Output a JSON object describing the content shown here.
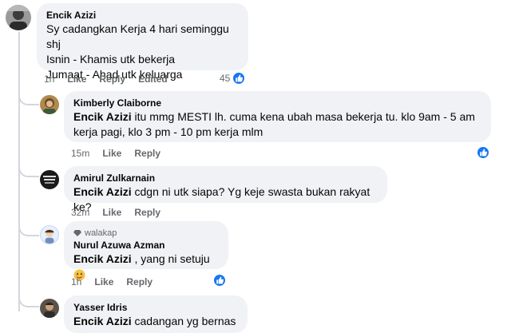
{
  "comments": [
    {
      "author": "Encik Azizi",
      "lines": [
        "Sy cadangkan Kerja 4 hari seminggu shj",
        "Isnin - Khamis utk bekerja",
        "Jumaat - Ahad utk keluarga"
      ],
      "time": "1h",
      "like": "Like",
      "reply": "Reply",
      "edited": "Edited",
      "reactions": "45"
    }
  ],
  "replies": [
    {
      "author": "Kimberly Claiborne",
      "mention": "Encik Azizi",
      "text_line1": " itu mmg MESTI lh. cuma kena ubah masa bekerja tu. klo 9am - 5 am",
      "text_line2": "kerja pagi, klo 3 pm - 10 pm kerja mlm",
      "time": "15m",
      "like": "Like",
      "reply": "Reply"
    },
    {
      "author": "Amirul Zulkarnain",
      "mention": "Encik Azizi",
      "text": " cdgn ni utk siapa? Yg keje swasta bukan rakyat ke?",
      "time": "32m",
      "like": "Like",
      "reply": "Reply"
    },
    {
      "badge": "walakap",
      "author": "Nurul Azuwa Azman",
      "mention": "Encik Azizi",
      "text": " , yang ni setuju ",
      "time": "1h",
      "like": "Like",
      "reply": "Reply"
    },
    {
      "author": "Yasser Idris",
      "mention": "Encik Azizi",
      "text": " cadangan yg bernas"
    }
  ],
  "icons": {
    "like_badge": "like-icon",
    "thumbs_emoji": "thumbs-up-emoji-icon",
    "smile_emoji": "smiling-emoji-icon",
    "diamond": "diamond-icon"
  },
  "colors": {
    "accent": "#1877f2",
    "bubble": "#f0f2f5",
    "meta": "#65676b"
  }
}
